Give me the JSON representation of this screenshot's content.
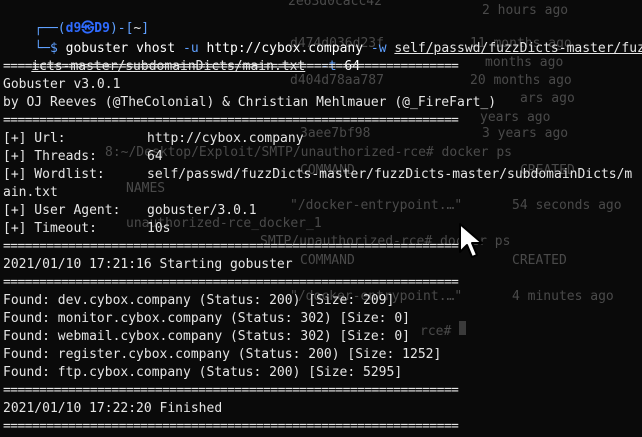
{
  "background_terminal": {
    "lines": [
      "2e63d0cacc42",
      "2 hours ago",
      "d474d036d23f",
      "11 months ago",
      "months ago",
      "d404d78aa787",
      "20 months ago",
      "ars ago",
      "years ago",
      "3aee7bf98",
      "3 years ago",
      "8:~/Desktop/Exploit/SMTP/unauthorized-rce# docker ps",
      "COMMAND",
      "CREATED",
      "NAMES",
      "\"/docker-entrypoint.…\"",
      "54 seconds ago",
      "unauthorized-rce_docker_1",
      "SMTP/unauthorized-rce# docker ps",
      "COMMAND",
      "CREATED",
      "\"/docker-entrypoint.…\"",
      "4 minutes ago",
      "rce#"
    ]
  },
  "prompt": {
    "user_host": "d9㉿D9",
    "cwd": "~",
    "dollar": "$"
  },
  "command": {
    "program": "gobuster",
    "subcommand": "vhost",
    "flag_u": "-u",
    "url": "http://cybox.company",
    "flag_w": "-w",
    "wordlist_part1": "self/passwd/fuzzDicts-master/fuzzD",
    "wordlist_part2": "icts-master/subdomainDicts/main.txt",
    "flag_t": "-t",
    "threads": "64"
  },
  "separator": "===============================================================",
  "banner": {
    "version": "Gobuster v3.0.1",
    "authors": "by OJ Reeves (@TheColonial) & Christian Mehlmauer (@_FireFart_)"
  },
  "config": [
    {
      "label": "[+] Url:",
      "value": "http://cybox.company"
    },
    {
      "label": "[+] Threads:",
      "value": "64"
    },
    {
      "label": "[+] Wordlist:",
      "value": "self/passwd/fuzzDicts-master/fuzzDicts-master/subdomainDicts/m"
    },
    {
      "label": "",
      "value": "ain.txt"
    },
    {
      "label": "[+] User Agent:",
      "value": "gobuster/3.0.1"
    },
    {
      "label": "[+] Timeout:",
      "value": "10s"
    }
  ],
  "start_message": "2021/01/10 17:21:16 Starting gobuster",
  "results": [
    "Found: dev.cybox.company (Status: 200) [Size: 209]",
    "Found: monitor.cybox.company (Status: 302) [Size: 0]",
    "Found: webmail.cybox.company (Status: 302) [Size: 0]",
    "Found: register.cybox.company (Status: 200) [Size: 1252]",
    "Found: ftp.cybox.company (Status: 200) [Size: 5295]"
  ],
  "finish_message": "2021/01/10 17:22:20 Finished"
}
